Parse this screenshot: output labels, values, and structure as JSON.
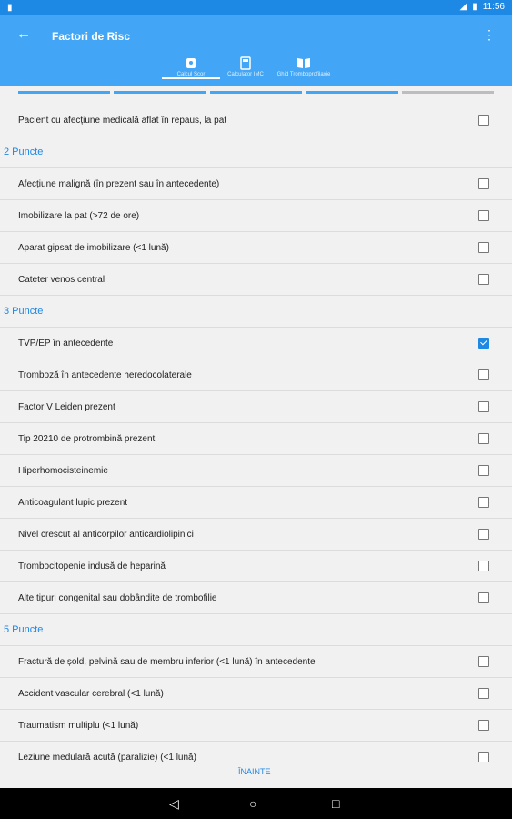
{
  "status": {
    "time": "11:56"
  },
  "appbar": {
    "title": "Factori de Risc"
  },
  "tabs": [
    {
      "label": "Calcul Scor"
    },
    {
      "label": "Calculator IMC"
    },
    {
      "label": "Ghid Tromboprofilaxie"
    }
  ],
  "progress": {
    "done_segments": 4,
    "total_segments": 5
  },
  "list": {
    "pre_rows": [
      {
        "label": "Pacient cu afecțiune medicală aflat în repaus, la pat",
        "checked": false
      }
    ],
    "sections": [
      {
        "title": "2 Puncte",
        "items": [
          {
            "label": "Afecțiune malignă (în prezent sau în antecedente)",
            "checked": false
          },
          {
            "label": "Imobilizare la pat (>72 de ore)",
            "checked": false
          },
          {
            "label": "Aparat gipsat de imobilizare (<1 lună)",
            "checked": false
          },
          {
            "label": "Cateter venos central",
            "checked": false
          }
        ]
      },
      {
        "title": "3 Puncte",
        "items": [
          {
            "label": "TVP/EP în antecedente",
            "checked": true
          },
          {
            "label": "Tromboză în antecedente heredocolaterale",
            "checked": false
          },
          {
            "label": "Factor V Leiden prezent",
            "checked": false
          },
          {
            "label": "Tip 20210 de protrombină prezent",
            "checked": false
          },
          {
            "label": "Hiperhomocisteinemie",
            "checked": false
          },
          {
            "label": "Anticoagulant lupic prezent",
            "checked": false
          },
          {
            "label": "Nivel crescut al anticorpilor anticardiolipinici",
            "checked": false
          },
          {
            "label": "Trombocitopenie indusă de heparină",
            "checked": false
          },
          {
            "label": "Alte tipuri congenital sau dobândite de trombofilie",
            "checked": false
          }
        ]
      },
      {
        "title": "5 Puncte",
        "items": [
          {
            "label": "Fractură de șold, pelvină sau de membru inferior (<1 lună) în antecedente",
            "checked": false
          },
          {
            "label": "Accident vascular cerebral (<1 lună)",
            "checked": false
          },
          {
            "label": "Traumatism multiplu (<1 lună)",
            "checked": false
          },
          {
            "label": "Leziune medulară acută (paralizie) (<1 lună)",
            "checked": false
          }
        ]
      }
    ]
  },
  "footer": {
    "next_label": "ÎNAINTE"
  },
  "colors": {
    "primary": "#42a5f5",
    "status_bar": "#1e88e5",
    "accent": "#1e88e5"
  },
  "icons": {
    "status_left": "sim-icon",
    "status_right": [
      "signal-icon",
      "battery-icon"
    ],
    "tabs": [
      "calculator-icon",
      "imc-icon",
      "book-icon"
    ],
    "nav": [
      "back-triangle-icon",
      "home-circle-icon",
      "recent-square-icon"
    ]
  }
}
